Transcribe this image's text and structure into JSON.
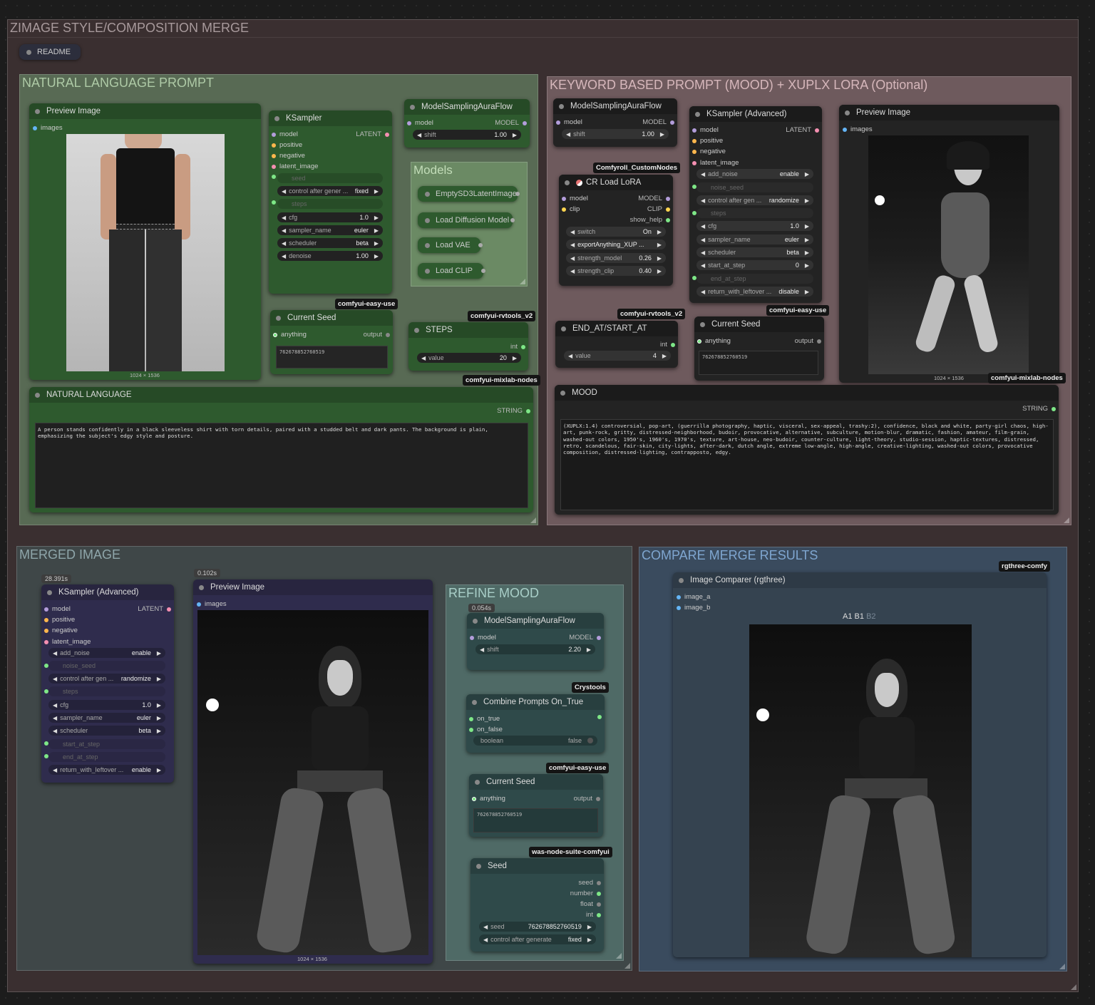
{
  "main_group": {
    "title": "ZIMAGE STYLE/COMPOSITION MERGE",
    "readme": "README"
  },
  "natural_group": {
    "title": "NATURAL LANGUAGE PROMPT",
    "preview": {
      "title": "Preview Image",
      "slot_images": "images",
      "caption": "1024 × 1536"
    },
    "ksampler": {
      "title": "KSampler",
      "inputs": [
        "model",
        "positive",
        "negative",
        "latent_image"
      ],
      "output": "LATENT",
      "seed_label": "seed",
      "control_label": "control after gener ...",
      "control_value": "fixed",
      "steps_label": "steps",
      "cfg_label": "cfg",
      "cfg_value": "1.0",
      "sampler_label": "sampler_name",
      "sampler_value": "euler",
      "scheduler_label": "scheduler",
      "scheduler_value": "beta",
      "denoise_label": "denoise",
      "denoise_value": "1.00"
    },
    "msaf": {
      "title": "ModelSamplingAuraFlow",
      "in": "model",
      "out": "MODEL",
      "shift_label": "shift",
      "shift_value": "1.00"
    },
    "models": {
      "title": "Models",
      "items": [
        "EmptySD3LatentImage",
        "Load Diffusion Model",
        "Load VAE",
        "Load CLIP"
      ]
    },
    "badge_easy": "comfyui-easy-use",
    "current_seed": {
      "title": "Current Seed",
      "in": "anything",
      "out": "output",
      "value": "762678852760519"
    },
    "badge_rvtools": "comfyui-rvtools_v2",
    "steps": {
      "title": "STEPS",
      "out": "int",
      "label": "value",
      "value": "20"
    },
    "badge_mixlab": "comfyui-mixlab-nodes",
    "natural_language": {
      "title": "NATURAL LANGUAGE",
      "out": "STRING",
      "text": "A person stands confidently in a black sleeveless shirt with torn details, paired with a studded belt and dark pants. The background is plain, emphasizing the subject's edgy style and posture."
    }
  },
  "keyword_group": {
    "title": "KEYWORD BASED PROMPT (MOOD) + XUPLX LORA (Optional)",
    "msaf": {
      "title": "ModelSamplingAuraFlow",
      "in": "model",
      "out": "MODEL",
      "shift_label": "shift",
      "shift_value": "1.00"
    },
    "badge_cr": "Comfyroll_CustomNodes",
    "cr_lora": {
      "title": "CR Load LoRA",
      "in_model": "model",
      "in_clip": "clip",
      "out_model": "MODEL",
      "out_clip": "CLIP",
      "out_help": "show_help",
      "switch_label": "switch",
      "switch_value": "On",
      "lora_value": "exportAnything_XUP ...",
      "strength_model_label": "strength_model",
      "strength_model_value": "0.26",
      "strength_clip_label": "strength_clip",
      "strength_clip_value": "0.40"
    },
    "ksampler_adv": {
      "title": "KSampler (Advanced)",
      "inputs": [
        "model",
        "positive",
        "negative",
        "latent_image"
      ],
      "output": "LATENT",
      "add_noise_label": "add_noise",
      "add_noise_value": "enable",
      "noise_seed_label": "noise_seed",
      "control_label": "control after gen ...",
      "control_value": "randomize",
      "steps_label": "steps",
      "cfg_label": "cfg",
      "cfg_value": "1.0",
      "sampler_label": "sampler_name",
      "sampler_value": "euler",
      "scheduler_label": "scheduler",
      "scheduler_value": "beta",
      "start_label": "start_at_step",
      "start_value": "0",
      "end_label": "end_at_step",
      "return_label": "return_with_leftover ...",
      "return_value": "disable"
    },
    "preview": {
      "title": "Preview Image",
      "slot_images": "images",
      "caption": "1024 × 1536"
    },
    "badge_rvtools": "comfyui-rvtools_v2",
    "badge_easy": "comfyui-easy-use",
    "badge_mixlab": "comfyui-mixlab-nodes",
    "end_at": {
      "title": "END_AT/START_AT",
      "out": "int",
      "label": "value",
      "value": "4"
    },
    "current_seed": {
      "title": "Current Seed",
      "in": "anything",
      "out": "output",
      "value": "762678852760519"
    },
    "mood": {
      "title": "MOOD",
      "out": "STRING",
      "text": "(XUPLX:1.4) controversial, pop-art, (guerrilla photography, haptic, visceral, sex-appeal, trashy:2), confidence, black and white, party-girl chaos, high-art, punk-rock, gritty, distressed-neighborhood, budoir, provocative, alternative, subculture, motion-blur, dramatic, fashion, amateur, film-grain, washed-out colors, 1950's, 1960's, 1970's, texture, art-house, neo-budoir, counter-culture, light-theory, studio-session, haptic-textures, distressed, retro, scandelous, fair-skin, city-lights, after-dark, dutch angle, extreme low-angle, high-angle, creative-lighting, washed-out colors, provocative composition, distressed-lighting, contrapposto, edgy."
    }
  },
  "merged_group": {
    "title": "MERGED IMAGE",
    "time_ks": "28.391s",
    "ksampler_adv": {
      "title": "KSampler (Advanced)",
      "inputs": [
        "model",
        "positive",
        "negative",
        "latent_image"
      ],
      "output": "LATENT",
      "add_noise_label": "add_noise",
      "add_noise_value": "enable",
      "noise_seed_label": "noise_seed",
      "control_label": "control after gen ...",
      "control_value": "randomize",
      "steps_label": "steps",
      "cfg_label": "cfg",
      "cfg_value": "1.0",
      "sampler_label": "sampler_name",
      "sampler_value": "euler",
      "scheduler_label": "scheduler",
      "scheduler_value": "beta",
      "start_label": "start_at_step",
      "end_label": "end_at_step",
      "return_label": "return_with_leftover ...",
      "return_value": "enable"
    },
    "time_preview": "0.102s",
    "preview": {
      "title": "Preview Image",
      "slot_images": "images",
      "caption": "1024 × 1536"
    }
  },
  "refine_group": {
    "title": "REFINE MOOD",
    "time": "0.054s",
    "msaf": {
      "title": "ModelSamplingAuraFlow",
      "in": "model",
      "out": "MODEL",
      "shift_label": "shift",
      "shift_value": "2.20"
    },
    "badge_crystools": "Crystools",
    "combine": {
      "title": "Combine Prompts On_True",
      "in_true": "on_true",
      "in_false": "on_false",
      "bool_label": "boolean",
      "bool_value": "false"
    },
    "badge_easy": "comfyui-easy-use",
    "current_seed": {
      "title": "Current Seed",
      "in": "anything",
      "out": "output",
      "value": "762678852760519"
    },
    "badge_was": "was-node-suite-comfyui",
    "seed": {
      "title": "Seed",
      "outs": [
        "seed",
        "number",
        "float",
        "int"
      ],
      "seed_label": "seed",
      "seed_value": "762678852760519",
      "control_label": "control after generate",
      "control_value": "fixed"
    }
  },
  "compare_group": {
    "title": "COMPARE MERGE RESULTS",
    "badge": "rgthree-comfy",
    "node": {
      "title": "Image Comparer (rgthree)",
      "in_a": "image_a",
      "in_b": "image_b",
      "label_a": "A1",
      "label_b1": "B1",
      "label_b2": "B2"
    }
  },
  "colors": {
    "green_group": "#5a6e55",
    "mauve_group": "#6e5a5d",
    "blue_group": "#3a4b5e",
    "teal_group": "#4f6a66",
    "purple_node": "#2f2c4d"
  }
}
